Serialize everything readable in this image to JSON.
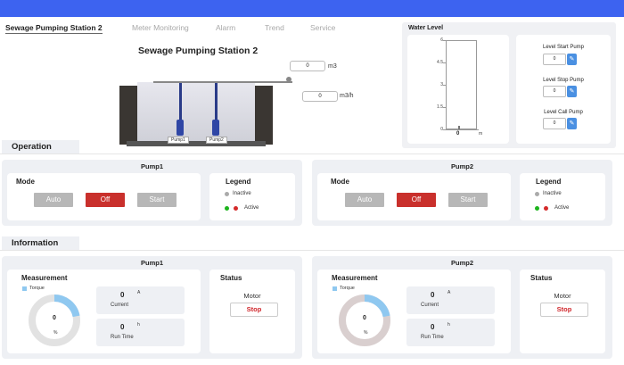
{
  "tabs": [
    "Sewage Pumping Station 2",
    "Meter Monitoring",
    "Alarm",
    "Trend",
    "Service"
  ],
  "station": {
    "title": "Sewage Pumping Station 2",
    "volume_value": "0",
    "volume_unit": "m3",
    "flow_value": "0",
    "flow_unit": "m3/h",
    "pump1_tag": "Pump1",
    "pump2_tag": "Pump2"
  },
  "water_level": {
    "title": "Water Level",
    "ticks": [
      "6",
      "4.5",
      "3",
      "1.5",
      "0"
    ],
    "value": "0",
    "unit": "m",
    "level_fraction": 0
  },
  "setpoints": [
    {
      "label": "Level Start Pump",
      "value": "0"
    },
    {
      "label": "Level Stop Pump",
      "value": "0"
    },
    {
      "label": "Level Call Pump",
      "value": "0"
    }
  ],
  "operation": {
    "section_title": "Operation",
    "pumps": [
      {
        "title": "Pump1",
        "mode_title": "Mode",
        "auto": "Auto",
        "off": "Off",
        "start": "Start",
        "legend_title": "Legend",
        "inactive": "Inactive",
        "active": "Active"
      },
      {
        "title": "Pump2",
        "mode_title": "Mode",
        "auto": "Auto",
        "off": "Off",
        "start": "Start",
        "legend_title": "Legend",
        "inactive": "Inactive",
        "active": "Active"
      }
    ]
  },
  "information": {
    "section_title": "Information",
    "pumps": [
      {
        "title": "Pump1",
        "measurement_title": "Measurement",
        "torque_label": "Torque",
        "gauge_value": "0",
        "gauge_unit": "%",
        "current_value": "0",
        "current_unit": "A",
        "current_label": "Current",
        "runtime_value": "0",
        "runtime_unit": "h",
        "runtime_label": "Run Time",
        "status_title": "Status",
        "motor_label": "Motor",
        "stop_label": "Stop",
        "torque_fraction": 0.22
      },
      {
        "title": "Pump2",
        "measurement_title": "Measurement",
        "torque_label": "Torque",
        "gauge_value": "0",
        "gauge_unit": "%",
        "current_value": "0",
        "current_unit": "A",
        "current_label": "Current",
        "runtime_value": "0",
        "runtime_unit": "h",
        "runtime_label": "Run Time",
        "status_title": "Status",
        "motor_label": "Motor",
        "stop_label": "Stop",
        "torque_fraction": 0.22
      }
    ]
  },
  "colors": {
    "accent": "#3d63f0",
    "off_button": "#c9302c",
    "inactive_dot": "#aaaaaa",
    "active_green": "#1db41d",
    "active_red": "#d42a2a",
    "gauge_fill": "#8fc8f0",
    "gauge_track_p1": "#e2e2e2",
    "gauge_track_p2": "#d9cfcf"
  }
}
